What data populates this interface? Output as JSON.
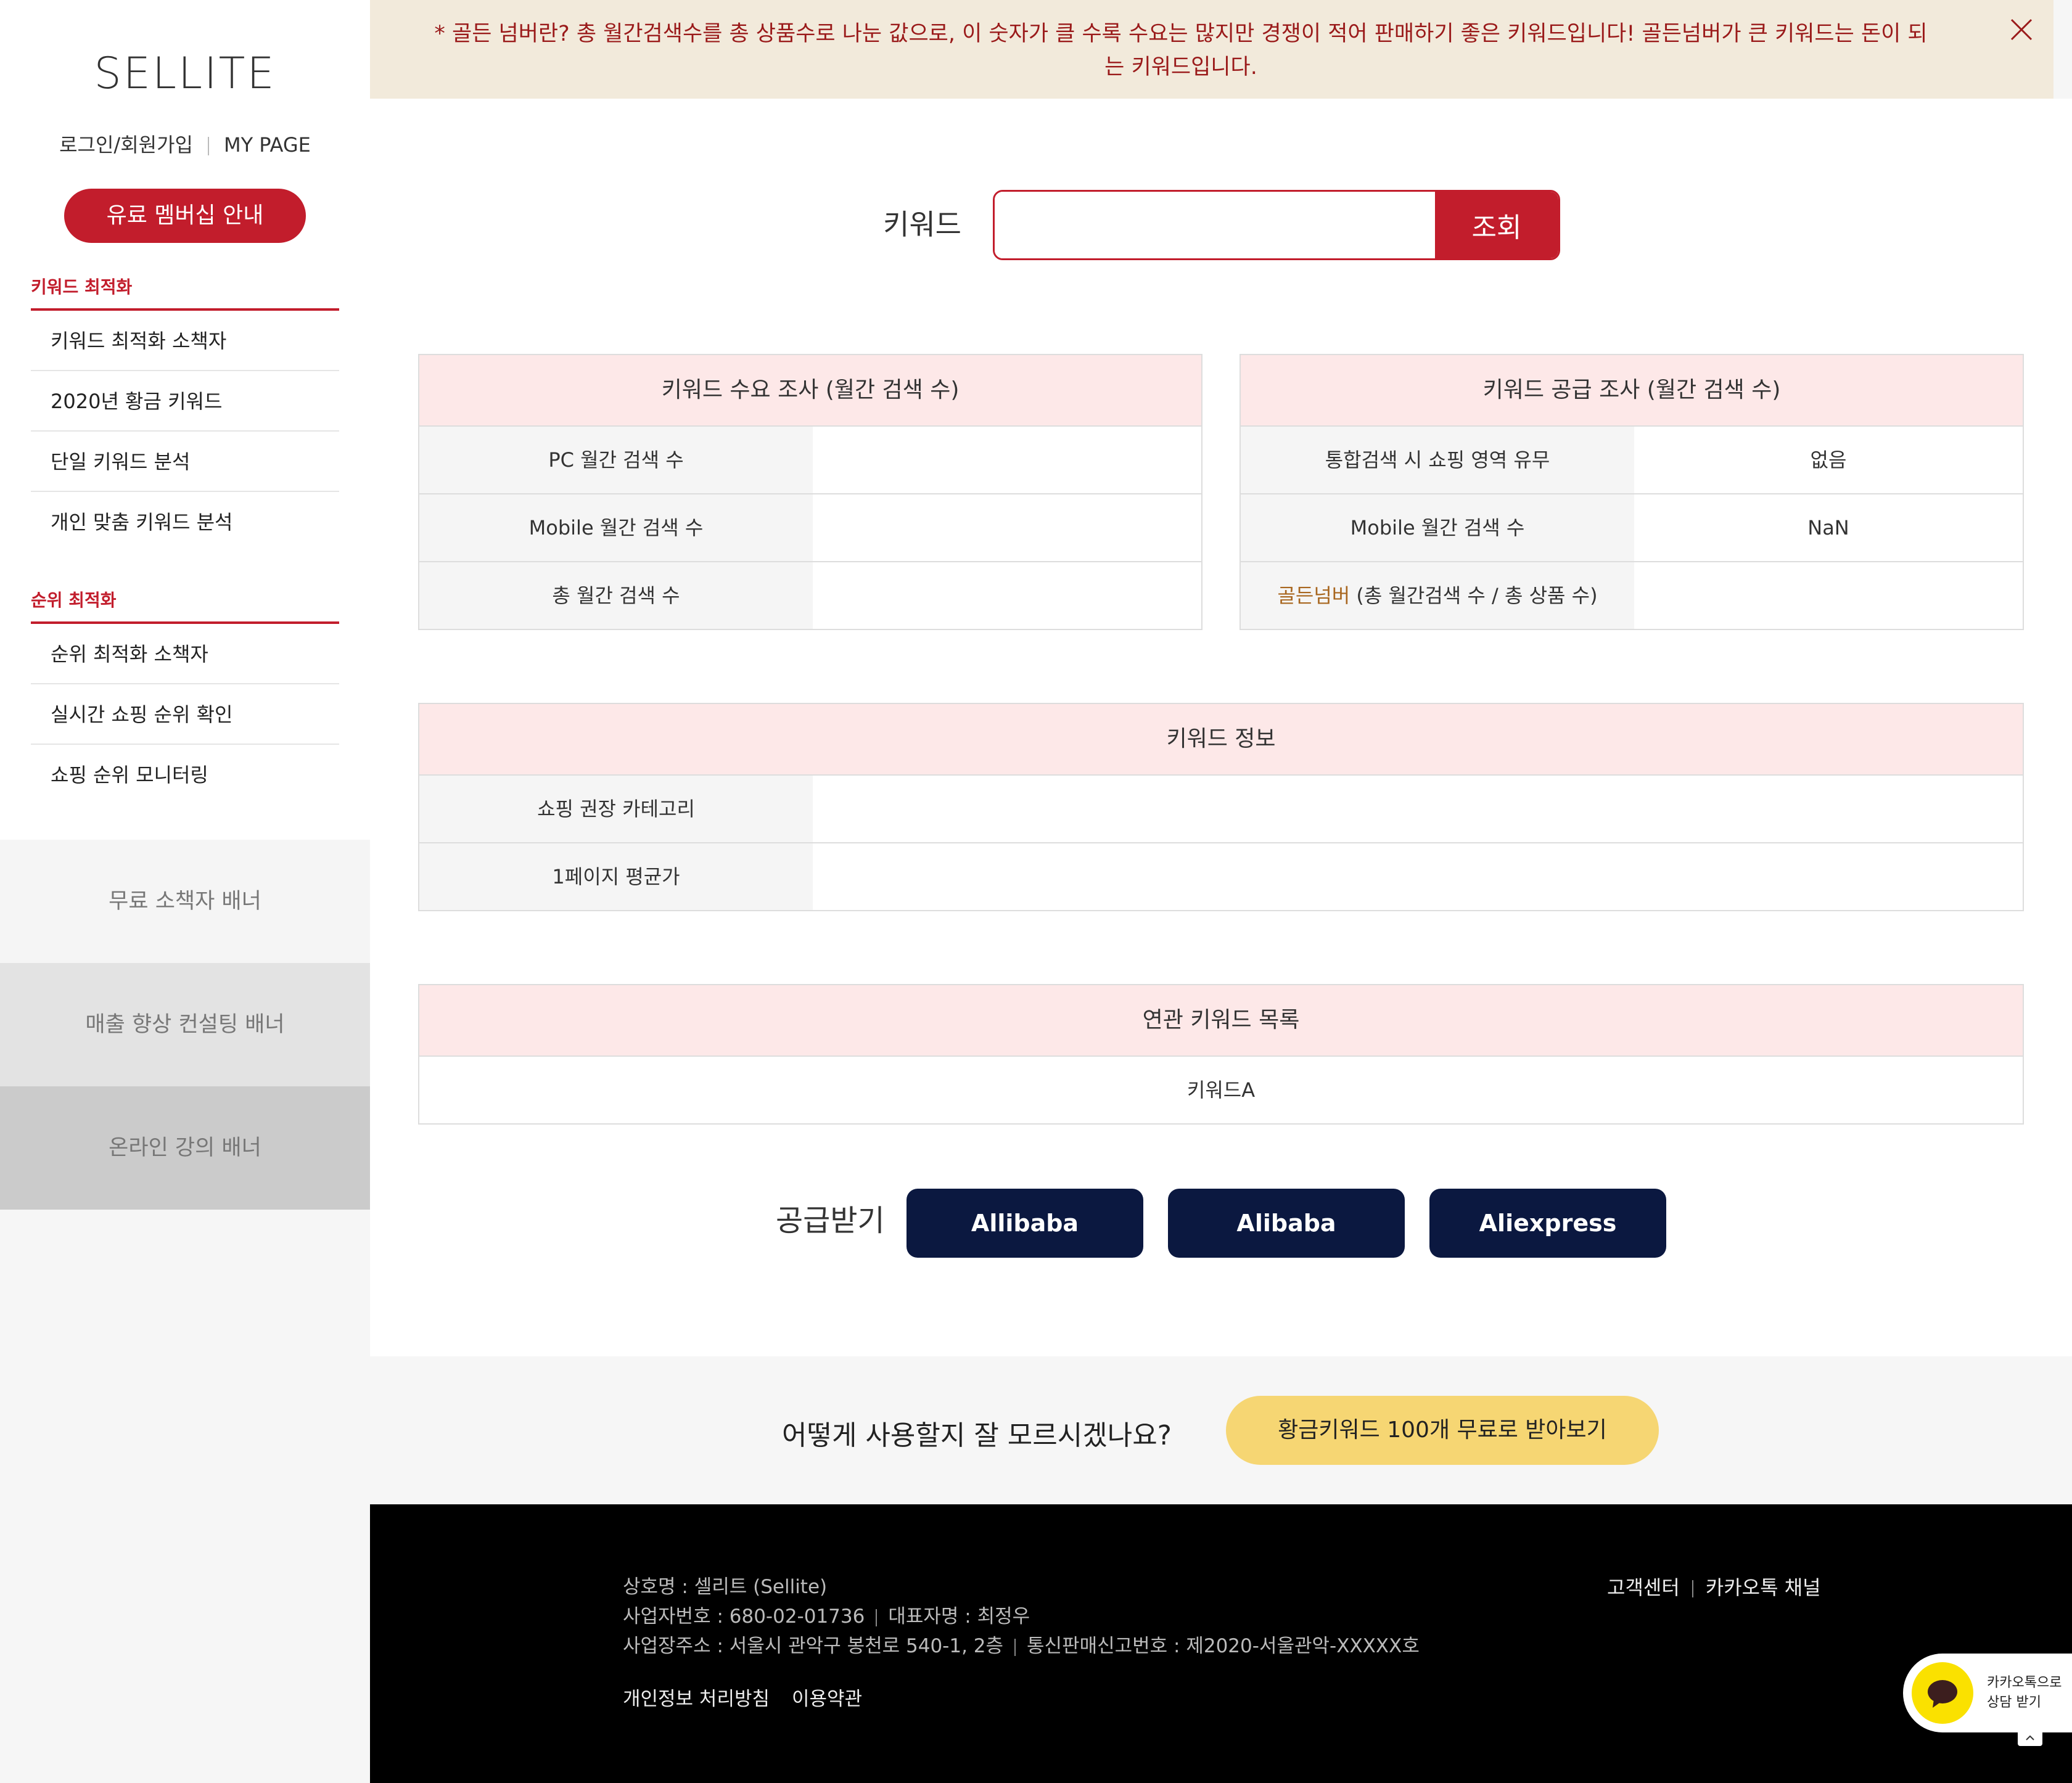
{
  "sidebar": {
    "logo": "SELLITE",
    "login": "로그인/회원가입",
    "mypage": "MY PAGE",
    "membership_button": "유료 멤버십 안내",
    "sections": [
      {
        "title": "키워드 최적화",
        "items": [
          "키워드 최적화 소책자",
          "2020년 황금 키워드",
          "단일 키워드 분석",
          "개인 맞춤 키워드 분석"
        ]
      },
      {
        "title": "순위 최적화",
        "items": [
          "순위 최적화 소책자",
          "실시간 쇼핑 순위 확인",
          "쇼핑 순위 모니터링"
        ]
      }
    ],
    "banners": [
      {
        "label": "무료 소책자 배너",
        "bg": "#f5f5f5"
      },
      {
        "label": "매출 향상 컨설팅 배너",
        "bg": "#e3e3e3"
      },
      {
        "label": "온라인 강의 배너",
        "bg": "#cbcbcb"
      }
    ]
  },
  "notice": {
    "text": "* 골든 넘버란? 총 월간검색수를 총 상품수로 나눈 값으로, 이 숫자가 클 수록 수요는 많지만 경쟁이 적어 판매하기 좋은 키워드입니다! 골든넘버가 큰 키워드는 돈이 되는 키워드입니다."
  },
  "search": {
    "label": "키워드",
    "placeholder": "",
    "value": "",
    "button": "조회"
  },
  "demand": {
    "title": "키워드 수요 조사 (월간 검색 수)",
    "rows": [
      {
        "label": "PC 월간 검색 수",
        "value": ""
      },
      {
        "label": "Mobile 월간 검색 수",
        "value": ""
      },
      {
        "label": "총 월간 검색 수",
        "value": ""
      }
    ]
  },
  "supply_survey": {
    "title": "키워드 공급 조사 (월간 검색 수)",
    "rows": [
      {
        "label": "통합검색 시 쇼핑 영역 유무",
        "value": "없음"
      },
      {
        "label": "Mobile 월간 검색 수",
        "value": "NaN"
      },
      {
        "label_highlight": "골든넘버",
        "label": " (총 월간검색 수 / 총 상품 수)",
        "value": ""
      }
    ]
  },
  "keyword_info": {
    "title": "키워드 정보",
    "rows": [
      {
        "label": "쇼핑 권장 카테고리",
        "value": ""
      },
      {
        "label": "1페이지 평균가",
        "value": ""
      }
    ]
  },
  "related": {
    "title": "연관 키워드 목록",
    "items": [
      "키워드A"
    ]
  },
  "supply": {
    "label": "공급받기",
    "buttons": [
      "Allibaba",
      "Alibaba",
      "Aliexpress"
    ]
  },
  "help": {
    "text": "어떻게 사용할지 잘 모르시겠나요?",
    "button": "황금키워드 100개 무료로 받아보기"
  },
  "footer": {
    "company": "상호명 : 셀리트 (Sellite)",
    "biz_number": "사업자번호 : 680-02-01736",
    "ceo": "대표자명 : 최정우",
    "address": "사업장주소 : 서울시 관악구 봉천로 540-1, 2층",
    "mail_order": "통신판매신고번호 : 제2020-서울관악-XXXXX호",
    "privacy": "개인정보 처리방침",
    "terms": "이용약관",
    "customer_center": "고객센터",
    "kakao_channel": "카카오톡 채널"
  },
  "kakao_widget": {
    "line1": "카카오톡으로",
    "line2": "상담 받기"
  },
  "colors": {
    "accent": "#c21d2c",
    "notice_bg": "#f2eadb",
    "panel_head": "#fde8e8",
    "supply_button": "#0b1840",
    "help_button": "#f6d673",
    "golden_number": "#a8661f"
  }
}
